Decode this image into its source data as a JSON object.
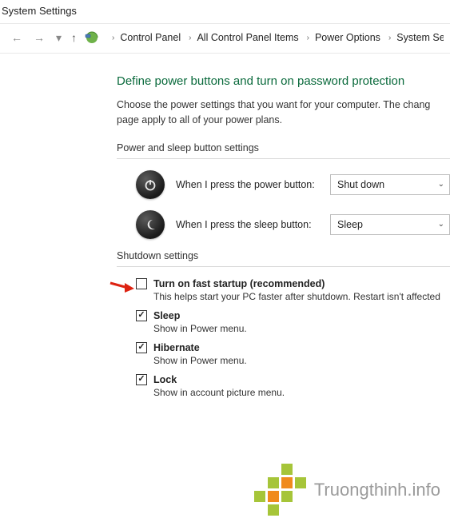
{
  "window": {
    "title": "System Settings"
  },
  "breadcrumb": {
    "items": [
      "Control Panel",
      "All Control Panel Items",
      "Power Options",
      "System Settin"
    ]
  },
  "page": {
    "heading": "Define power buttons and turn on password protection",
    "description": "Choose the power settings that you want for your computer. The chang  page apply to all of your power plans."
  },
  "power_sleep": {
    "section_label": "Power and sleep button settings",
    "power_label": "When I press the power button:",
    "power_value": "Shut down",
    "sleep_label": "When I press the sleep button:",
    "sleep_value": "Sleep"
  },
  "shutdown": {
    "section_label": "Shutdown settings",
    "items": [
      {
        "label": "Turn on fast startup (recommended)",
        "desc": "This helps start your PC faster after shutdown. Restart isn't affected",
        "checked": false
      },
      {
        "label": "Sleep",
        "desc": "Show in Power menu.",
        "checked": true
      },
      {
        "label": "Hibernate",
        "desc": "Show in Power menu.",
        "checked": true
      },
      {
        "label": "Lock",
        "desc": "Show in account picture menu.",
        "checked": true
      }
    ]
  },
  "watermark": {
    "text": "Truongthinh.info"
  }
}
